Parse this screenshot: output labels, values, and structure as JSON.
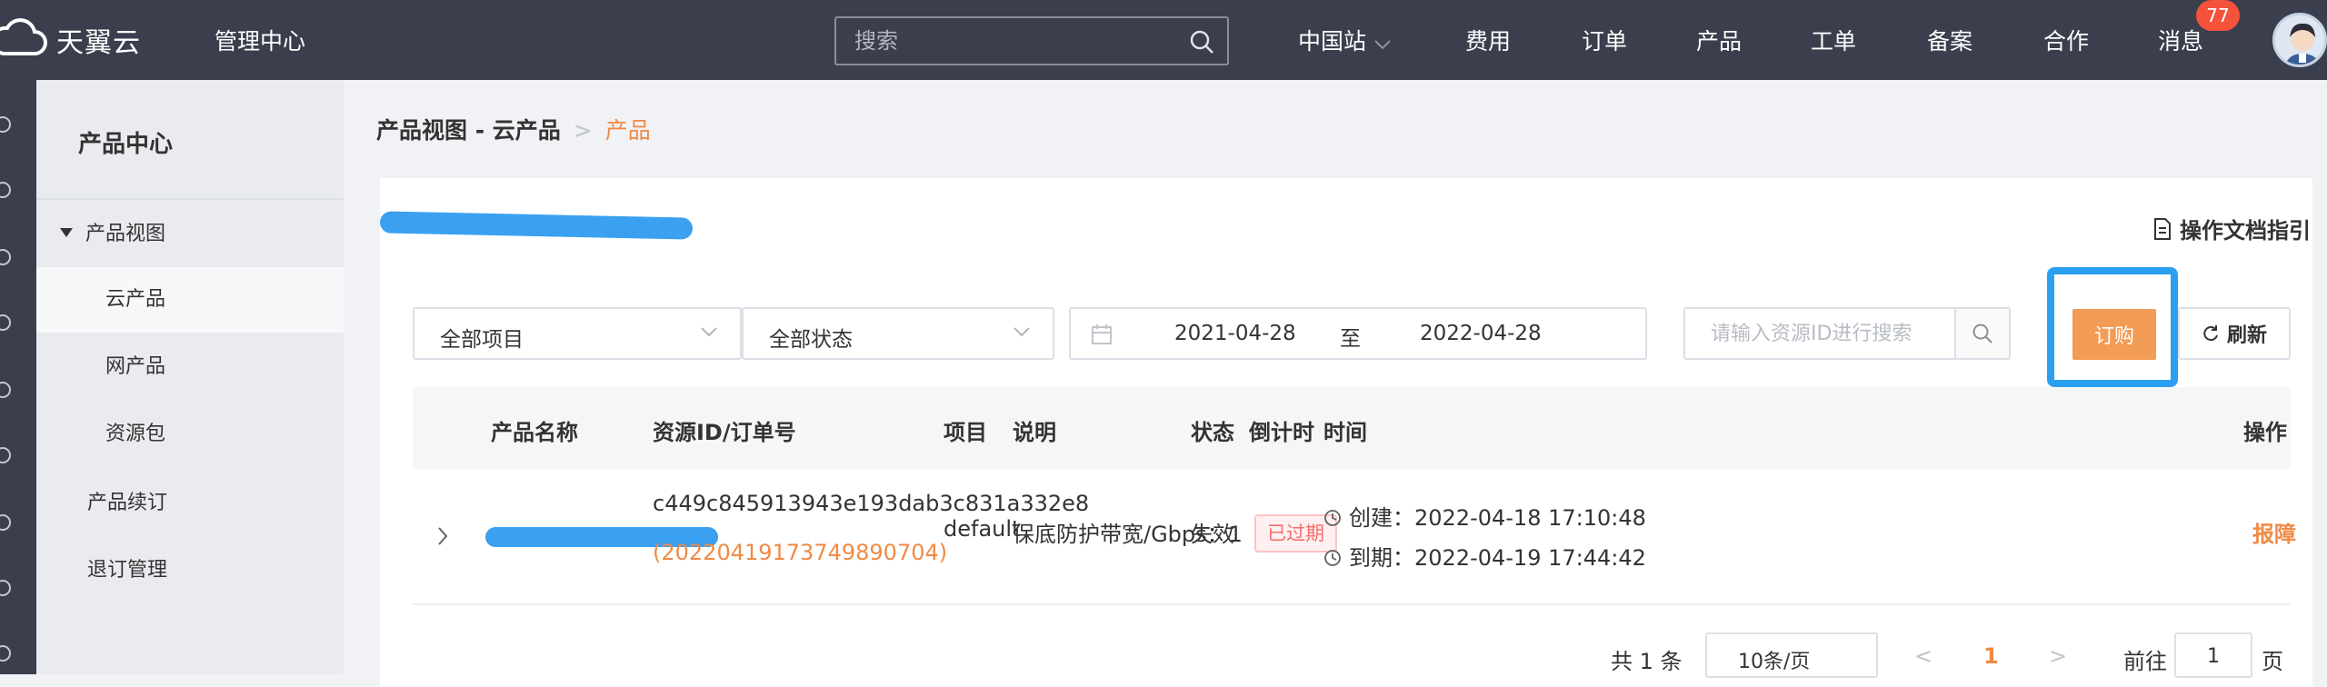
{
  "header": {
    "brand": "天翼云",
    "console_label": "管理中心",
    "search_placeholder": "搜索",
    "nav": {
      "region": "中国站",
      "billing": "费用",
      "orders": "订单",
      "products": "产品",
      "tickets": "工单",
      "filing": "备案",
      "partner": "合作",
      "messages": "消息"
    },
    "message_count": "77"
  },
  "sidebar": {
    "title": "产品中心",
    "items": [
      {
        "label": "产品视图"
      },
      {
        "label": "云产品"
      },
      {
        "label": "网产品"
      },
      {
        "label": "资源包"
      },
      {
        "label": "产品续订"
      },
      {
        "label": "退订管理"
      }
    ]
  },
  "breadcrumb": {
    "parent": "产品视图 - 云产品",
    "current": "产品"
  },
  "card": {
    "doc_link": "操作文档指引"
  },
  "filters": {
    "project": "全部项目",
    "status": "全部状态",
    "date_from": "2021-04-28",
    "date_separator": "至",
    "date_to": "2022-04-28",
    "id_search_placeholder": "请输入资源ID进行搜索",
    "order_button": "订购",
    "refresh_button": "刷新"
  },
  "table": {
    "columns": [
      "产品名称",
      "资源ID/订单号",
      "项目",
      "说明",
      "状态",
      "倒计时",
      "时间",
      "操作"
    ],
    "rows": [
      {
        "resource_id": "c449c845913943e193dab3c831a332e8",
        "order_no": "(20220419173749890704)",
        "project": "default",
        "description": "保底防护带宽/Gbps：1",
        "status": "失效",
        "countdown": "已过期",
        "created": "创建：2022-04-18 17:10:48",
        "expires": "到期：2022-04-19 17:44:42",
        "action": "报障"
      }
    ]
  },
  "pagination": {
    "total": "共 1 条",
    "page_size": "10条/页",
    "current_page": "1",
    "goto_label": "前往",
    "goto_value": "1",
    "page_suffix": "页"
  }
}
